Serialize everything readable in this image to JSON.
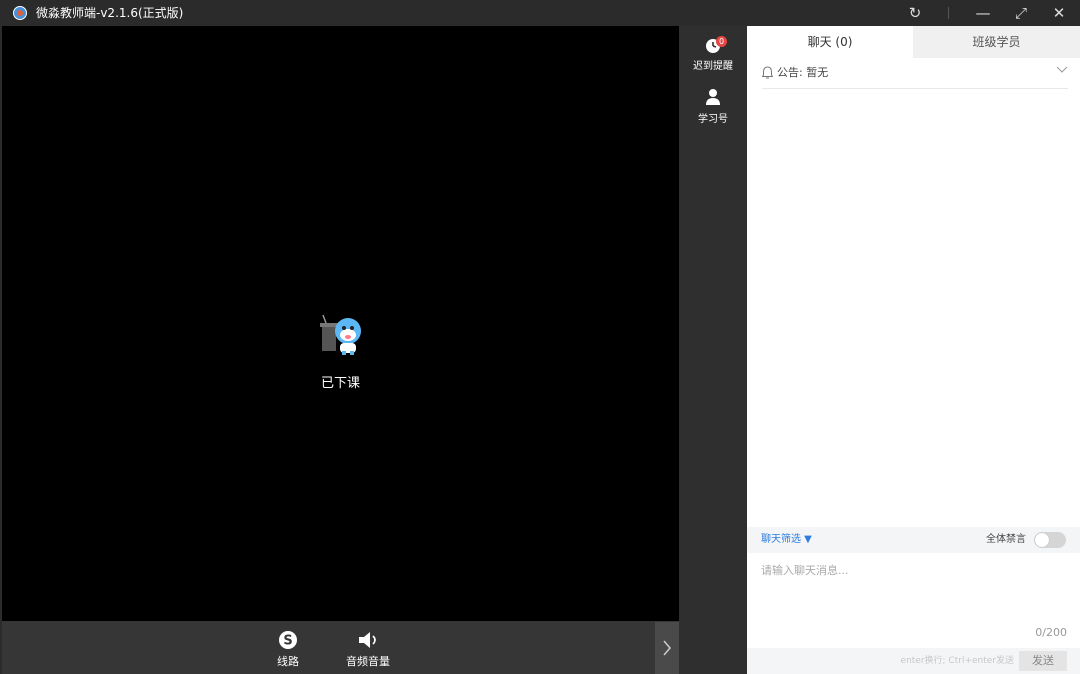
{
  "window": {
    "title": "微淼教师端-v2.1.6(正式版)",
    "controls": {
      "refresh": "↻",
      "minimize": "—",
      "maximize": "⤢",
      "close": "✕"
    }
  },
  "video": {
    "status_label": "已下课"
  },
  "bottom_controls": {
    "line_label": "线路",
    "audio_label": "音频音量",
    "collapse_icon": "chevron-right-icon"
  },
  "toolbar": {
    "late_reminder_label": "迟到提醒",
    "late_reminder_badge": "0",
    "study_id_label": "学习号"
  },
  "side_panel": {
    "tabs": [
      {
        "label": "聊天 (0)",
        "active": true
      },
      {
        "label": "班级学员",
        "active": false
      }
    ],
    "announcement": "公告: 暂无",
    "chat_filter_label": "聊天筛选 ▼",
    "mute_all_label": "全体禁言",
    "mute_all_on": false,
    "input_placeholder": "请输入聊天消息...",
    "char_counter": "0/200",
    "send_hint": "enter换行; Ctrl+enter发送",
    "send_label": "发送"
  },
  "colors": {
    "titlebar": "#2b2b2b",
    "toolbar": "#2f2f2f",
    "accent": "#2d7de0",
    "badge": "#e84545"
  }
}
